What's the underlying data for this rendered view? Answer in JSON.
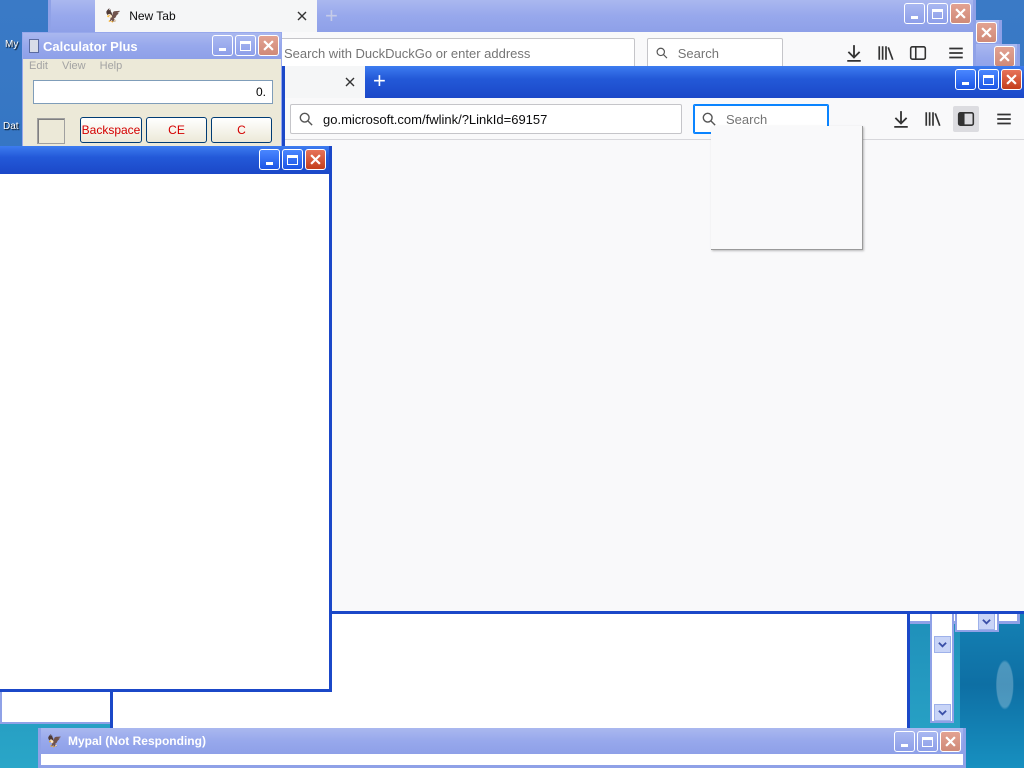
{
  "desktop": {
    "icon_labels": [
      "My",
      "Dat"
    ]
  },
  "back_browser": {
    "tab_title": "New Tab",
    "url_placeholder": "Search with DuckDuckGo or enter address",
    "search_placeholder": "Search"
  },
  "front_browser": {
    "url_value": "go.microsoft.com/fwlink/?LinkId=69157",
    "search_placeholder": "Search"
  },
  "calculator": {
    "title": "Calculator Plus",
    "menu": [
      "Edit",
      "View",
      "Help"
    ],
    "display": "0.",
    "buttons": {
      "backspace": "Backspace",
      "ce": "CE",
      "c": "C"
    }
  },
  "mypal": {
    "title": "Mypal (Not Responding)"
  },
  "colors": {
    "xp_title_blue": "#2359d8",
    "xp_faded": "#97a8ec",
    "close_red": "#c43e1c",
    "calc_button_text": "#d40000",
    "firefox_accent": "#0a84ff"
  }
}
